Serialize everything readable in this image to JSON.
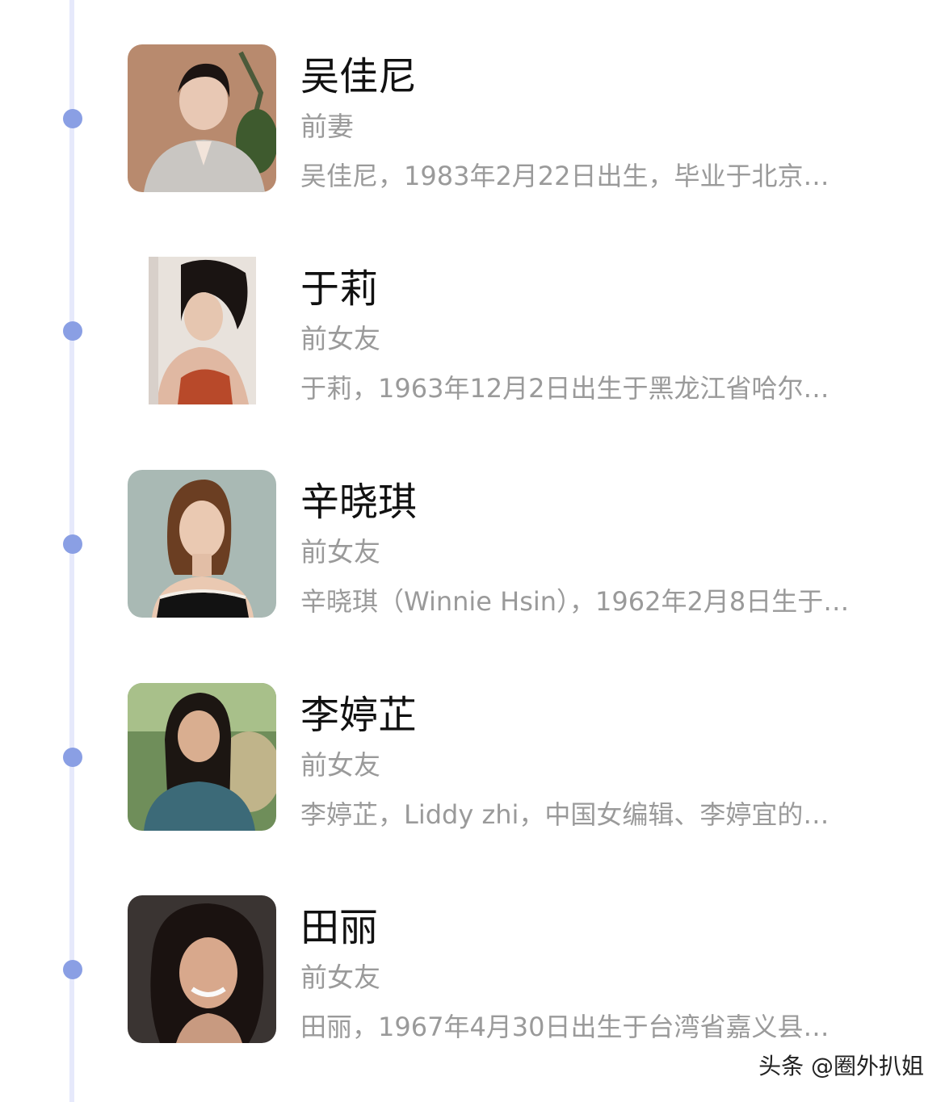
{
  "entries": [
    {
      "name": "吴佳尼",
      "relation": "前妻",
      "description": "吴佳尼，1983年2月22日出生，毕业于北京…",
      "photo_icon": "portrait-photo",
      "photo_bg": "#b88a6e"
    },
    {
      "name": "于莉",
      "relation": "前女友",
      "description": "于莉，1963年12月2日出生于黑龙江省哈尔…",
      "photo_icon": "portrait-photo",
      "photo_bg": "#e8e2dc"
    },
    {
      "name": "辛晓琪",
      "relation": "前女友",
      "description": "辛晓琪（Winnie Hsin），1962年2月8日生于…",
      "photo_icon": "portrait-photo",
      "photo_bg": "#a9b9b4"
    },
    {
      "name": "李婷芷",
      "relation": "前女友",
      "description": "李婷芷，Liddy zhi，中国女编辑、李婷宜的…",
      "photo_icon": "portrait-photo",
      "photo_bg": "#6f8e5a"
    },
    {
      "name": "田丽",
      "relation": "前女友",
      "description": "田丽，1967年4月30日出生于台湾省嘉义县…",
      "photo_icon": "portrait-photo",
      "photo_bg": "#3a3432"
    }
  ],
  "watermark": "头条 @圈外扒姐",
  "colors": {
    "timeline": "#e6e9fb",
    "dot": "#8a9fe4",
    "name": "#111111",
    "secondary": "#9a9a9a"
  }
}
